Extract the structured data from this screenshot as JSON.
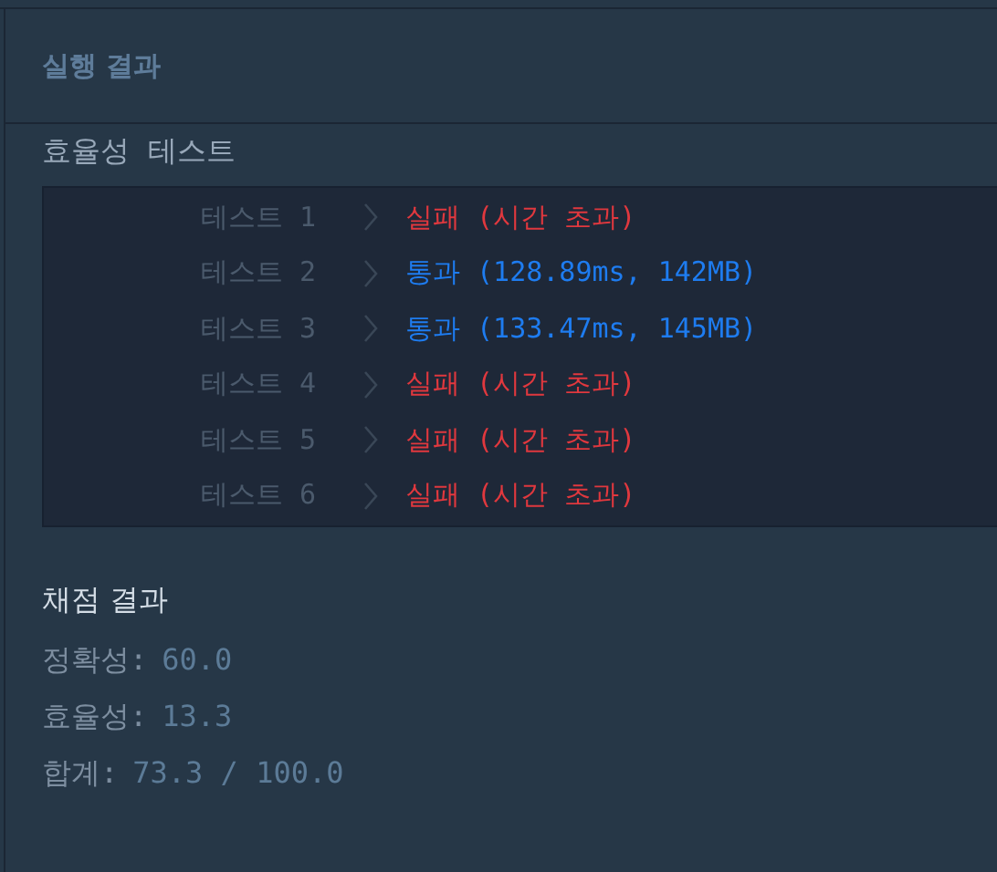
{
  "panel": {
    "title": "실행 결과"
  },
  "section": {
    "title": "효율성  테스트"
  },
  "tests": [
    {
      "label": "테스트 1",
      "kind": "fail",
      "result": "실패 (시간 초과)"
    },
    {
      "label": "테스트 2",
      "kind": "pass",
      "result": "통과 (128.89ms, 142MB)"
    },
    {
      "label": "테스트 3",
      "kind": "pass",
      "result": "통과 (133.47ms, 145MB)"
    },
    {
      "label": "테스트 4",
      "kind": "fail",
      "result": "실패 (시간 초과)"
    },
    {
      "label": "테스트 5",
      "kind": "fail",
      "result": "실패 (시간 초과)"
    },
    {
      "label": "테스트 6",
      "kind": "fail",
      "result": "실패 (시간 초과)"
    }
  ],
  "grading": {
    "title": "채점 결과",
    "scores": [
      {
        "label": "정확성:",
        "value": "60.0"
      },
      {
        "label": "효율성:",
        "value": "13.3"
      },
      {
        "label": "합계:",
        "value": "73.3 / 100.0"
      }
    ]
  }
}
